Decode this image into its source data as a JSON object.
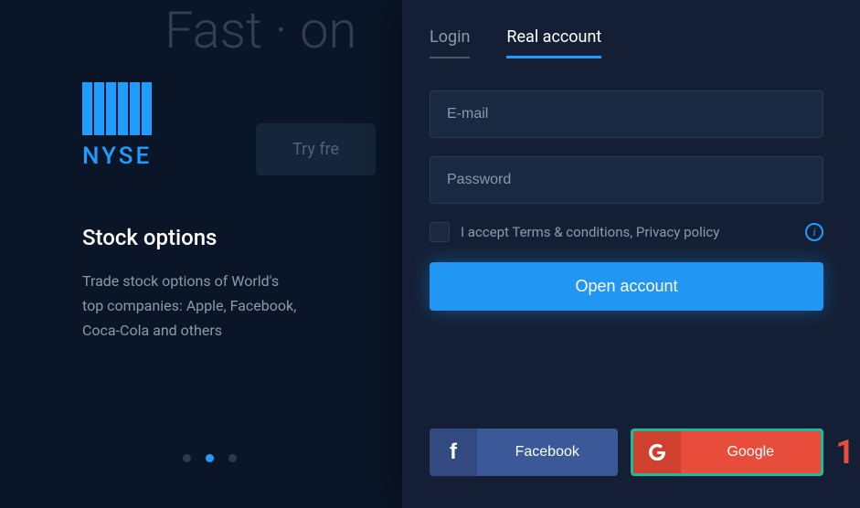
{
  "background": {
    "headline": "Fast · on",
    "try_button": "Try fre"
  },
  "promo": {
    "brand": "NYSE",
    "title": "Stock options",
    "text_line1": "Trade stock options of World's",
    "text_line2": "top companies: Apple, Facebook,",
    "text_line3": "Coca-Cola and others"
  },
  "tabs": {
    "login": "Login",
    "real_account": "Real account"
  },
  "form": {
    "email_placeholder": "E-mail",
    "password_placeholder": "Password",
    "terms_text": "I accept Terms & conditions, Privacy policy",
    "submit_label": "Open account"
  },
  "social": {
    "facebook": "Facebook",
    "google": "Google"
  },
  "annotation": {
    "number": "1"
  },
  "colors": {
    "accent": "#1e9cff",
    "primary_button": "#2196f3",
    "facebook": "#3b5998",
    "google": "#e84d3c",
    "highlight_border": "#1abc9c"
  }
}
